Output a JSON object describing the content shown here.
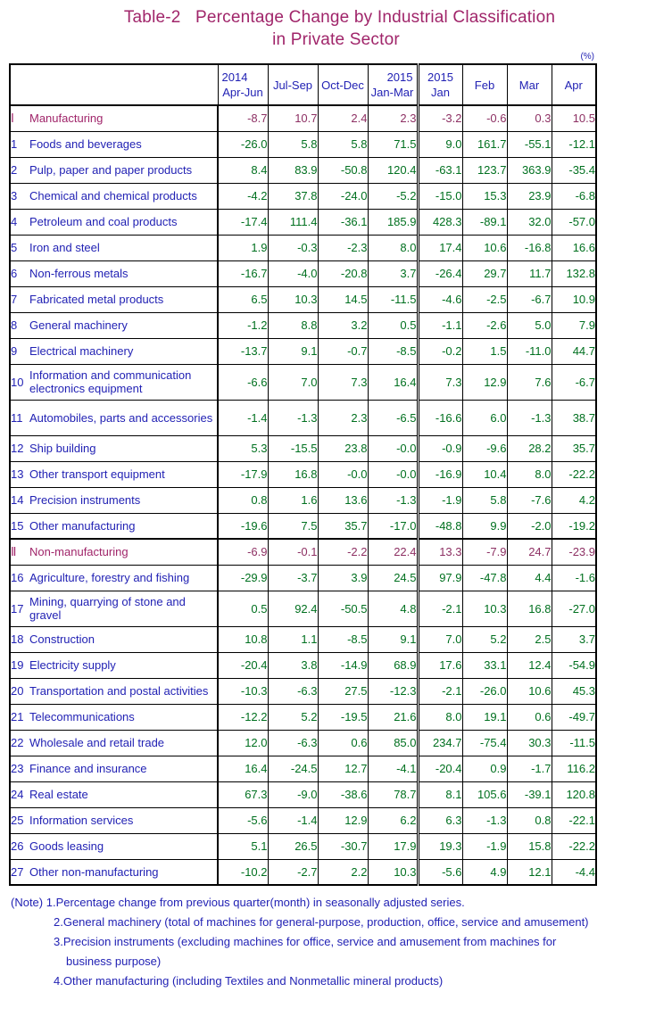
{
  "title": {
    "line1": "Table-2   Percentage Change by Industrial Classification",
    "line2": "in Private Sector"
  },
  "unit": "(%)",
  "header": {
    "blank_label": "",
    "quarters": [
      {
        "year": "2014",
        "period": "Apr-Jun",
        "align": "left"
      },
      {
        "year": "",
        "period": "Jul-Sep",
        "align": "left"
      },
      {
        "year": "",
        "period": "Oct-Dec",
        "align": "left"
      },
      {
        "year": "2015",
        "period": "Jan-Mar",
        "align": "right"
      }
    ],
    "months": [
      {
        "year": "2015",
        "period": "Jan"
      },
      {
        "year": "",
        "period": "Feb"
      },
      {
        "year": "",
        "period": "Mar"
      },
      {
        "year": "",
        "period": "Apr"
      }
    ]
  },
  "colors": {
    "title": "#a0256a",
    "label": "#2222b4",
    "value": "#00701f",
    "section": "#a0256a",
    "section_value": "#8d3063",
    "border": "#000000"
  },
  "rows": [
    {
      "num": "Ⅰ",
      "label": "Manufacturing",
      "type": "section",
      "values": [
        "-8.7",
        "10.7",
        "2.4",
        "2.3",
        "-3.2",
        "-0.6",
        "0.3",
        "10.5"
      ]
    },
    {
      "num": "1",
      "label": "Foods and beverages",
      "type": "item",
      "values": [
        "-26.0",
        "5.8",
        "5.8",
        "71.5",
        "9.0",
        "161.7",
        "-55.1",
        "-12.1"
      ]
    },
    {
      "num": "2",
      "label": "Pulp, paper and paper products",
      "type": "item",
      "values": [
        "8.4",
        "83.9",
        "-50.8",
        "120.4",
        "-63.1",
        "123.7",
        "363.9",
        "-35.4"
      ]
    },
    {
      "num": "3",
      "label": "Chemical and chemical products",
      "type": "item",
      "values": [
        "-4.2",
        "37.8",
        "-24.0",
        "-5.2",
        "-15.0",
        "15.3",
        "23.9",
        "-6.8"
      ]
    },
    {
      "num": "4",
      "label": "Petroleum and coal products",
      "type": "item",
      "values": [
        "-17.4",
        "111.4",
        "-36.1",
        "185.9",
        "428.3",
        "-89.1",
        "32.0",
        "-57.0"
      ]
    },
    {
      "num": "5",
      "label": "Iron and steel",
      "type": "item",
      "values": [
        "1.9",
        "-0.3",
        "-2.3",
        "8.0",
        "17.4",
        "10.6",
        "-16.8",
        "16.6"
      ]
    },
    {
      "num": "6",
      "label": "Non-ferrous metals",
      "type": "item",
      "values": [
        "-16.7",
        "-4.0",
        "-20.8",
        "3.7",
        "-26.4",
        "29.7",
        "11.7",
        "132.8"
      ]
    },
    {
      "num": "7",
      "label": "Fabricated metal products",
      "type": "item",
      "values": [
        "6.5",
        "10.3",
        "14.5",
        "-11.5",
        "-4.6",
        "-2.5",
        "-6.7",
        "10.9"
      ]
    },
    {
      "num": "8",
      "label": "General machinery",
      "type": "item",
      "values": [
        "-1.2",
        "8.8",
        "3.2",
        "0.5",
        "-1.1",
        "-2.6",
        "5.0",
        "7.9"
      ]
    },
    {
      "num": "9",
      "label": "Electrical machinery",
      "type": "item",
      "values": [
        "-13.7",
        "9.1",
        "-0.7",
        "-8.5",
        "-0.2",
        "1.5",
        "-11.0",
        "44.7"
      ]
    },
    {
      "num": "10",
      "label": "Information and communication electronics equipment",
      "type": "item-tall",
      "values": [
        "-6.6",
        "7.0",
        "7.3",
        "16.4",
        "7.3",
        "12.9",
        "7.6",
        "-6.7"
      ]
    },
    {
      "num": "11",
      "label": "Automobiles, parts and accessories",
      "type": "item-tall",
      "values": [
        "-1.4",
        "-1.3",
        "2.3",
        "-6.5",
        "-16.6",
        "6.0",
        "-1.3",
        "38.7"
      ]
    },
    {
      "num": "12",
      "label": "Ship building",
      "type": "item",
      "values": [
        "5.3",
        "-15.5",
        "23.8",
        "-0.0",
        "-0.9",
        "-9.6",
        "28.2",
        "35.7"
      ]
    },
    {
      "num": "13",
      "label": "Other transport equipment",
      "type": "item",
      "values": [
        "-17.9",
        "16.8",
        "-0.0",
        "-0.0",
        "-16.9",
        "10.4",
        "8.0",
        "-22.2"
      ]
    },
    {
      "num": "14",
      "label": "Precision instruments",
      "type": "item",
      "values": [
        "0.8",
        "1.6",
        "13.6",
        "-1.3",
        "-1.9",
        "5.8",
        "-7.6",
        "4.2"
      ]
    },
    {
      "num": "15",
      "label": "Other manufacturing",
      "type": "item",
      "values": [
        "-19.6",
        "7.5",
        "35.7",
        "-17.0",
        "-48.8",
        "9.9",
        "-2.0",
        "-19.2"
      ]
    },
    {
      "num": "Ⅱ",
      "label": "Non-manufacturing",
      "type": "section",
      "values": [
        "-6.9",
        "-0.1",
        "-2.2",
        "22.4",
        "13.3",
        "-7.9",
        "24.7",
        "-23.9"
      ]
    },
    {
      "num": "16",
      "label": "Agriculture, forestry and fishing",
      "type": "item",
      "values": [
        "-29.9",
        "-3.7",
        "3.9",
        "24.5",
        "97.9",
        "-47.8",
        "4.4",
        "-1.6"
      ]
    },
    {
      "num": "17",
      "label": "Mining, quarrying of stone and gravel",
      "type": "item-tall",
      "values": [
        "0.5",
        "92.4",
        "-50.5",
        "4.8",
        "-2.1",
        "10.3",
        "16.8",
        "-27.0"
      ]
    },
    {
      "num": "18",
      "label": "Construction",
      "type": "item",
      "values": [
        "10.8",
        "1.1",
        "-8.5",
        "9.1",
        "7.0",
        "5.2",
        "2.5",
        "3.7"
      ]
    },
    {
      "num": "19",
      "label": "Electricity supply",
      "type": "item",
      "values": [
        "-20.4",
        "3.8",
        "-14.9",
        "68.9",
        "17.6",
        "33.1",
        "12.4",
        "-54.9"
      ]
    },
    {
      "num": "20",
      "label": "Transportation and postal activities",
      "type": "item",
      "values": [
        "-10.3",
        "-6.3",
        "27.5",
        "-12.3",
        "-2.1",
        "-26.0",
        "10.6",
        "45.3"
      ]
    },
    {
      "num": "21",
      "label": "Telecommunications",
      "type": "item",
      "values": [
        "-12.2",
        "5.2",
        "-19.5",
        "21.6",
        "8.0",
        "19.1",
        "0.6",
        "-49.7"
      ]
    },
    {
      "num": "22",
      "label": "Wholesale and retail trade",
      "type": "item",
      "values": [
        "12.0",
        "-6.3",
        "0.6",
        "85.0",
        "234.7",
        "-75.4",
        "30.3",
        "-11.5"
      ]
    },
    {
      "num": "23",
      "label": "Finance and insurance",
      "type": "item",
      "values": [
        "16.4",
        "-24.5",
        "12.7",
        "-4.1",
        "-20.4",
        "0.9",
        "-1.7",
        "116.2"
      ]
    },
    {
      "num": "24",
      "label": "Real estate",
      "type": "item",
      "values": [
        "67.3",
        "-9.0",
        "-38.6",
        "78.7",
        "8.1",
        "105.6",
        "-39.1",
        "120.8"
      ]
    },
    {
      "num": "25",
      "label": "Information services",
      "type": "item",
      "values": [
        "-5.6",
        "-1.4",
        "12.9",
        "6.2",
        "6.3",
        "-1.3",
        "0.8",
        "-22.1"
      ]
    },
    {
      "num": "26",
      "label": "Goods leasing",
      "type": "item",
      "values": [
        "5.1",
        "26.5",
        "-30.7",
        "17.9",
        "19.3",
        "-1.9",
        "15.8",
        "-22.2"
      ]
    },
    {
      "num": "27",
      "label": "Other non-manufacturing",
      "type": "item",
      "values": [
        "-10.2",
        "-2.7",
        "2.2",
        "10.3",
        "-5.6",
        "4.9",
        "12.1",
        "-4.4"
      ]
    }
  ],
  "notes": [
    {
      "indent": 1,
      "text": "(Note) 1.Percentage change from previous quarter(month) in seasonally adjusted series."
    },
    {
      "indent": 2,
      "text": "2.General machinery (total of machines for general-purpose, production, office, service and amusement)"
    },
    {
      "indent": 2,
      "text": "3.Precision instruments (excluding machines for office, service and amusement from machines for"
    },
    {
      "indent": 3,
      "text": "business purpose)"
    },
    {
      "indent": 2,
      "text": "4.Other manufacturing (including Textiles and Nonmetallic mineral products)"
    }
  ]
}
